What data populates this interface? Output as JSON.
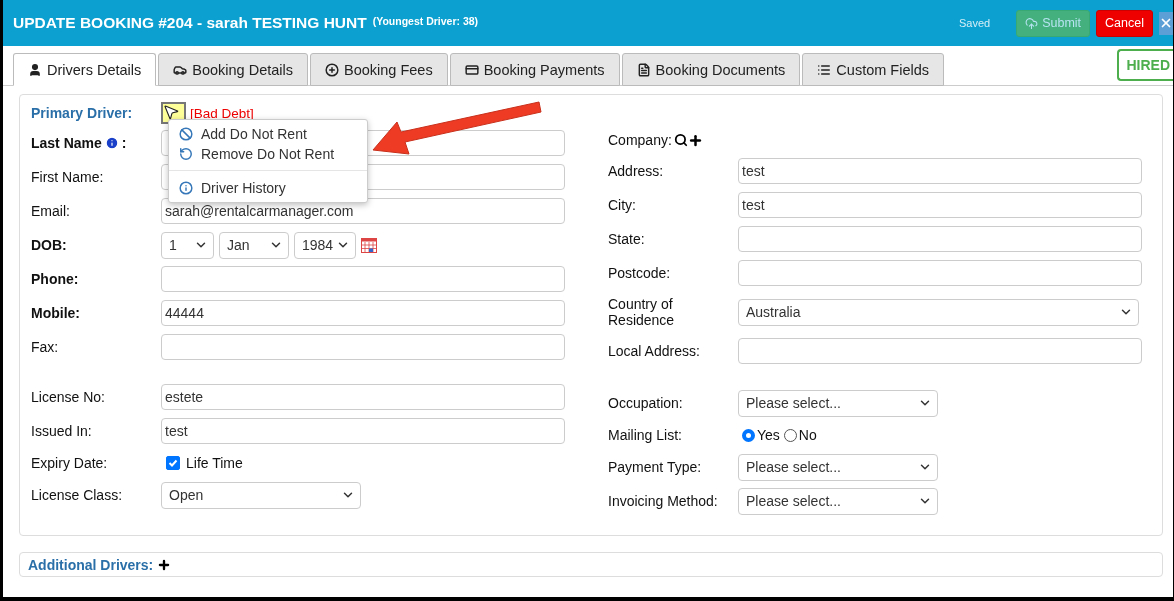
{
  "header": {
    "title": "UPDATE BOOKING #204 - sarah TESTING HUNT",
    "subtitle": "(Youngest Driver: 38)",
    "status": "Saved",
    "buttons": [
      {
        "label": "Submit",
        "kind": "submit",
        "disabled": true
      },
      {
        "label": "Cancel",
        "kind": "cancel",
        "disabled": false
      }
    ]
  },
  "tabs": [
    {
      "label": "Drivers Details",
      "kind": "user",
      "selected": true
    },
    {
      "label": "Booking Details",
      "kind": "car",
      "selected": false
    },
    {
      "label": "Booking Fees",
      "kind": "plus",
      "selected": false
    },
    {
      "label": "Booking Payments",
      "kind": "card",
      "selected": false
    },
    {
      "label": "Booking Documents",
      "kind": "file",
      "selected": false
    },
    {
      "label": "Custom Fields",
      "kind": "list",
      "selected": false
    }
  ],
  "badge": "HIRED",
  "primary_driver": {
    "label": "Primary Driver:",
    "flag": "[Bad Debt]"
  },
  "menu": {
    "items": [
      {
        "label": "Add Do Not Rent",
        "kind": "ban",
        "separated": false
      },
      {
        "label": "Remove Do Not Rent",
        "kind": "undo",
        "separated": false
      },
      {
        "label": "Driver History",
        "kind": "info",
        "separated": true
      }
    ]
  },
  "left_groups": [
    [
      {
        "label": "Last Name",
        "kind": "text",
        "bold": true,
        "info": true,
        "label_end": ":"
      },
      {
        "label": "First Name:",
        "kind": "text",
        "bold": false
      },
      {
        "label": "Email:",
        "kind": "text",
        "bold": false,
        "value": "sarah@rentalcarmanager.com"
      },
      {
        "label": "DOB:",
        "kind": "dob",
        "bold": true,
        "options": [
          "1",
          "Jan",
          "1984"
        ]
      },
      {
        "label": "Phone:",
        "kind": "text",
        "bold": true
      },
      {
        "label": "Mobile:",
        "kind": "text",
        "bold": true,
        "value": "44444"
      },
      {
        "label": "Fax:",
        "kind": "text",
        "bold": false
      }
    ],
    [
      {
        "label": "License No:",
        "kind": "text",
        "bold": false,
        "value": "estete"
      },
      {
        "label": "Issued In:",
        "kind": "text",
        "bold": false,
        "value": "test"
      },
      {
        "label": "Expiry Date:",
        "kind": "checkbox",
        "bold": false,
        "value": "Life Time",
        "checked": true
      },
      {
        "label": "License Class:",
        "kind": "select",
        "bold": false,
        "value": "Open"
      }
    ]
  ],
  "right_groups": [
    [
      {
        "label": "Company:",
        "kind": "company"
      },
      {
        "label": "Address:",
        "kind": "text",
        "value": "test"
      },
      {
        "label": "City:",
        "kind": "text",
        "value": "test"
      },
      {
        "label": "State:",
        "kind": "text"
      },
      {
        "label": "Postcode:",
        "kind": "text"
      },
      {
        "label": "Country of Residence",
        "kind": "wideselect",
        "value": "Australia"
      },
      {
        "label": "Local Address:",
        "kind": "text"
      }
    ],
    [
      {
        "label": "Occupation:",
        "kind": "select",
        "value": "Please select..."
      },
      {
        "label": "Mailing List:",
        "kind": "radio",
        "options": [
          {
            "label": "Yes",
            "selected": true
          },
          {
            "label": "No",
            "selected": false
          }
        ]
      },
      {
        "label": "Payment Type:",
        "kind": "select",
        "value": "Please select..."
      },
      {
        "label": "Invoicing Method:",
        "kind": "select",
        "value": "Please select..."
      }
    ]
  ],
  "additional_drivers": {
    "label": "Additional Drivers:"
  }
}
